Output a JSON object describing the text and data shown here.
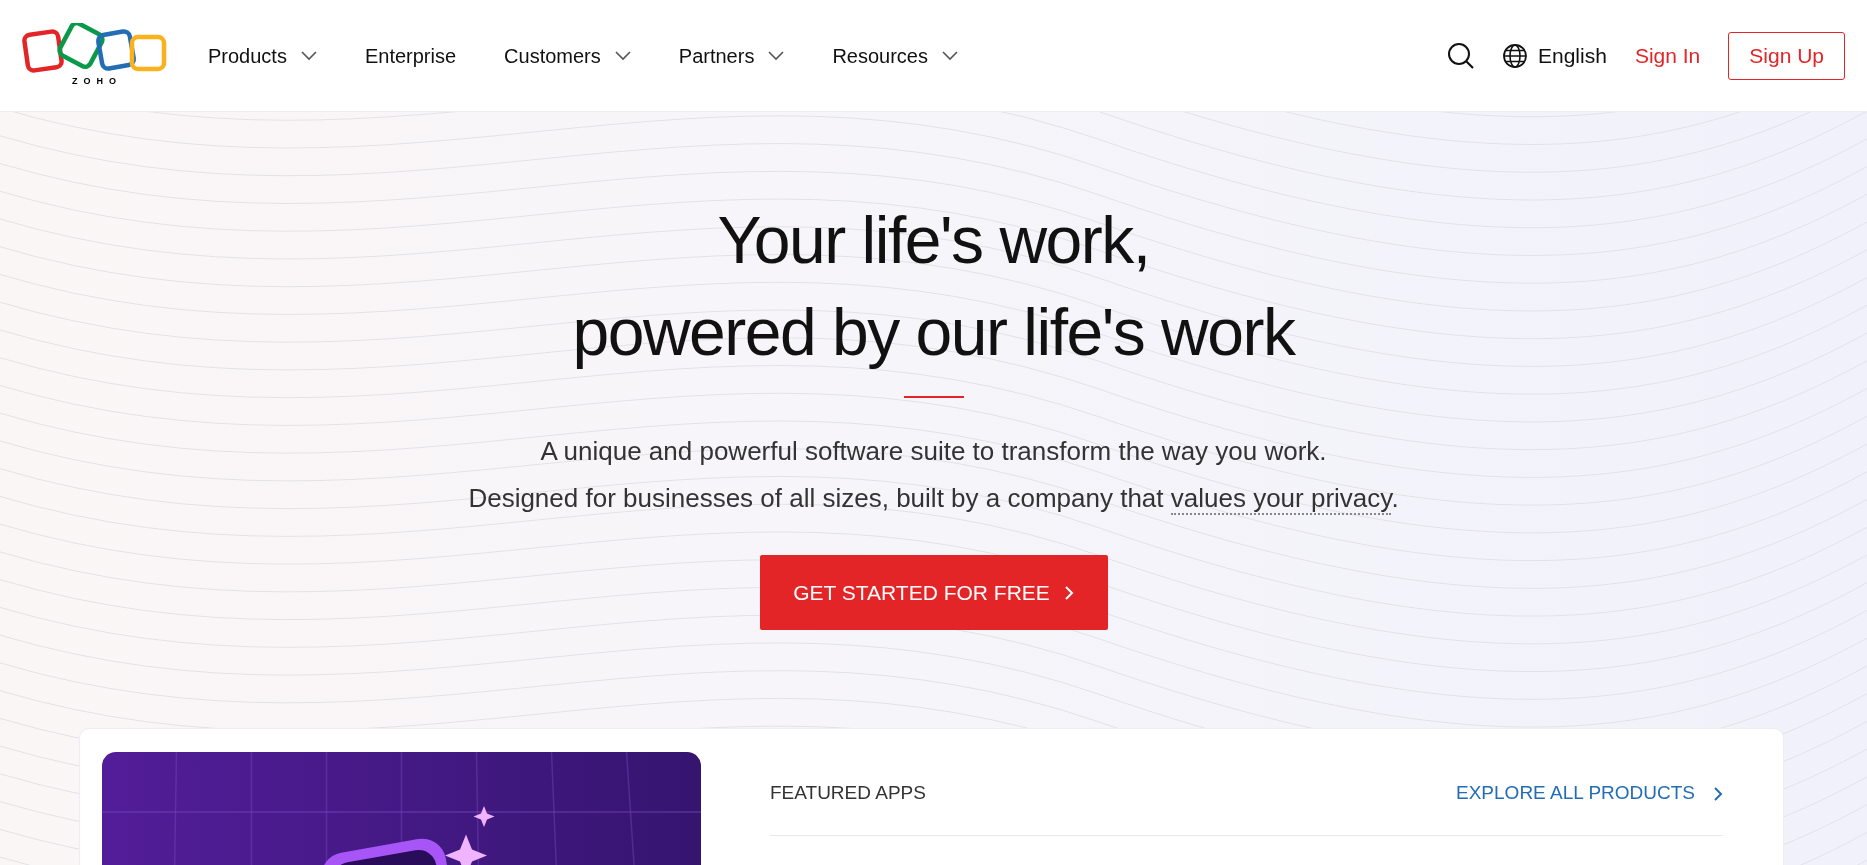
{
  "header": {
    "logo_text": "ZOHO",
    "nav": [
      {
        "label": "Products",
        "dropdown": true
      },
      {
        "label": "Enterprise",
        "dropdown": false
      },
      {
        "label": "Customers",
        "dropdown": true
      },
      {
        "label": "Partners",
        "dropdown": true
      },
      {
        "label": "Resources",
        "dropdown": true
      }
    ],
    "language": "English",
    "sign_in": "Sign In",
    "sign_up": "Sign Up"
  },
  "hero": {
    "title_lines": [
      "Your life's work,",
      "powered by our life's work"
    ],
    "subtitle": {
      "line1": "A unique and powerful software suite to transform the way you work.",
      "line2": "Designed for businesses of all sizes, built by a company that ",
      "link": "values your privacy",
      "end": "."
    },
    "cta": "GET STARTED FOR FREE"
  },
  "featured": {
    "heading": "FEATURED APPS",
    "explore": "EXPLORE ALL PRODUCTS"
  }
}
